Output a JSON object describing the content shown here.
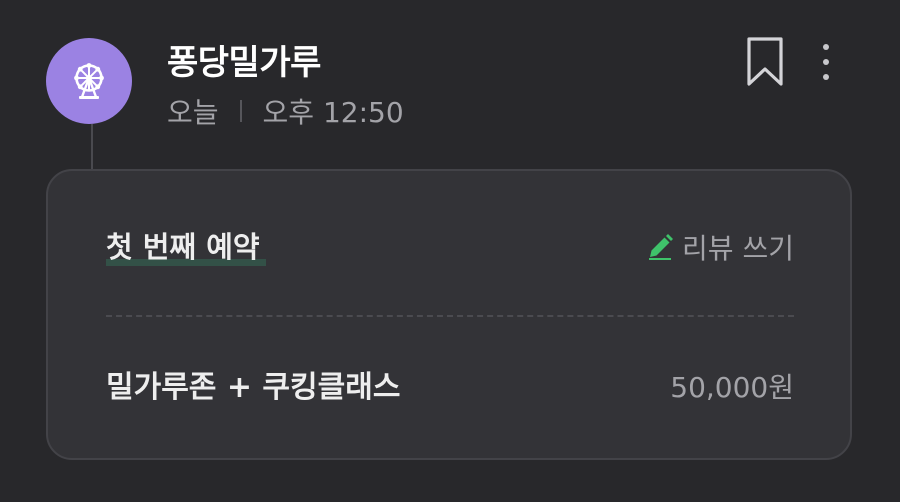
{
  "header": {
    "store_name": "퐁당밀가루",
    "date": "오늘",
    "time": "오후 12:50",
    "avatar_icon": "ferris-wheel-icon",
    "avatar_color": "#9b82e3"
  },
  "actions": {
    "bookmark_icon": "bookmark-icon",
    "more_icon": "more-vertical-icon"
  },
  "card": {
    "badge": "첫 번째 예약",
    "review_label": "리뷰 쓰기",
    "review_icon": "pencil-icon",
    "review_icon_color": "#3fc26a",
    "item_name": "밀가루존 + 쿠킹클래스",
    "item_price": "50,000원"
  }
}
